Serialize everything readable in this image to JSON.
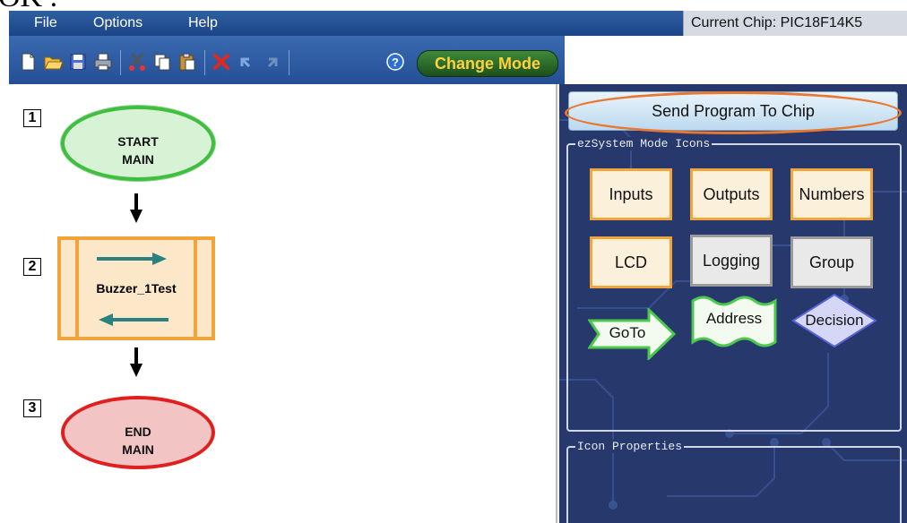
{
  "menu": {
    "items": [
      {
        "label": "File"
      },
      {
        "label": "Options"
      },
      {
        "label": "Help"
      }
    ],
    "chip_label": "Current Chip: PIC18F14K5"
  },
  "toolbar": {
    "icons": [
      "new-file-icon",
      "open-folder-icon",
      "save-icon",
      "print-icon",
      "cut-icon",
      "copy-icon",
      "paste-icon",
      "delete-icon",
      "undo-icon",
      "redo-icon",
      "help-icon"
    ],
    "change_mode_label": "Change Mode"
  },
  "flowchart": {
    "nodes": [
      {
        "number": "1",
        "line1": "START",
        "line2": "MAIN"
      },
      {
        "number": "2",
        "label": "Buzzer_1Test"
      },
      {
        "number": "3",
        "line1": "END",
        "line2": "MAIN"
      }
    ]
  },
  "panel": {
    "send_button": "Send Program To Chip",
    "icons_group_title": "ezSystem Mode Icons",
    "icon_buttons": [
      {
        "label": "Inputs"
      },
      {
        "label": "Outputs"
      },
      {
        "label": "Numbers"
      },
      {
        "label": "LCD"
      },
      {
        "label": "Logging"
      },
      {
        "label": "Group"
      },
      {
        "label": "GoTo"
      },
      {
        "label": "Address"
      },
      {
        "label": "Decision"
      }
    ],
    "properties_group_title": "Icon Properties"
  },
  "colors": {
    "start_border": "#3fbf3f",
    "end_border": "#e01f1f",
    "macro_border": "#f2a43a",
    "panel_bg": "#27386c",
    "highlight_ring": "#e9772f"
  }
}
